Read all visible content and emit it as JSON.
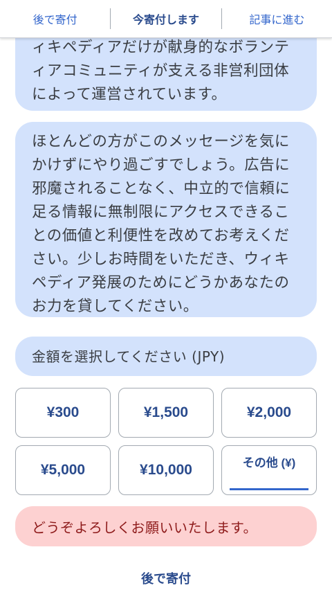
{
  "topbar": {
    "later": "後で寄付",
    "donate_now": "今寄付します",
    "go_article": "記事に進む"
  },
  "messages": {
    "bubble1": "ィキペディアだけが献身的なボランティアコミュニティが支える非営利団体によって運営されています。",
    "bubble2": "ほとんどの方がこのメッセージを気にかけずにやり過ごすでしょう。広告に邪魔されることなく、中立的で信頼に足る情報に無制限にアクセスできることの価値と利便性を改めてお考えください。少しお時間をいただき、ウィキペディア発展のためにどうかあなたのお力を貸してください。",
    "select_amount": "金額を選択してください (JPY)"
  },
  "amounts": [
    "¥300",
    "¥1,500",
    "¥2,000",
    "¥5,000",
    "¥10,000"
  ],
  "other_amount_label": "その他 (¥)",
  "thanks": "どうぞよろしくお願いいたします。",
  "bottom_later": "後で寄付",
  "colors": {
    "link_blue": "#3366cc",
    "bubble_blue": "#d3e2fc",
    "bubble_pink": "#fdd1d1"
  }
}
